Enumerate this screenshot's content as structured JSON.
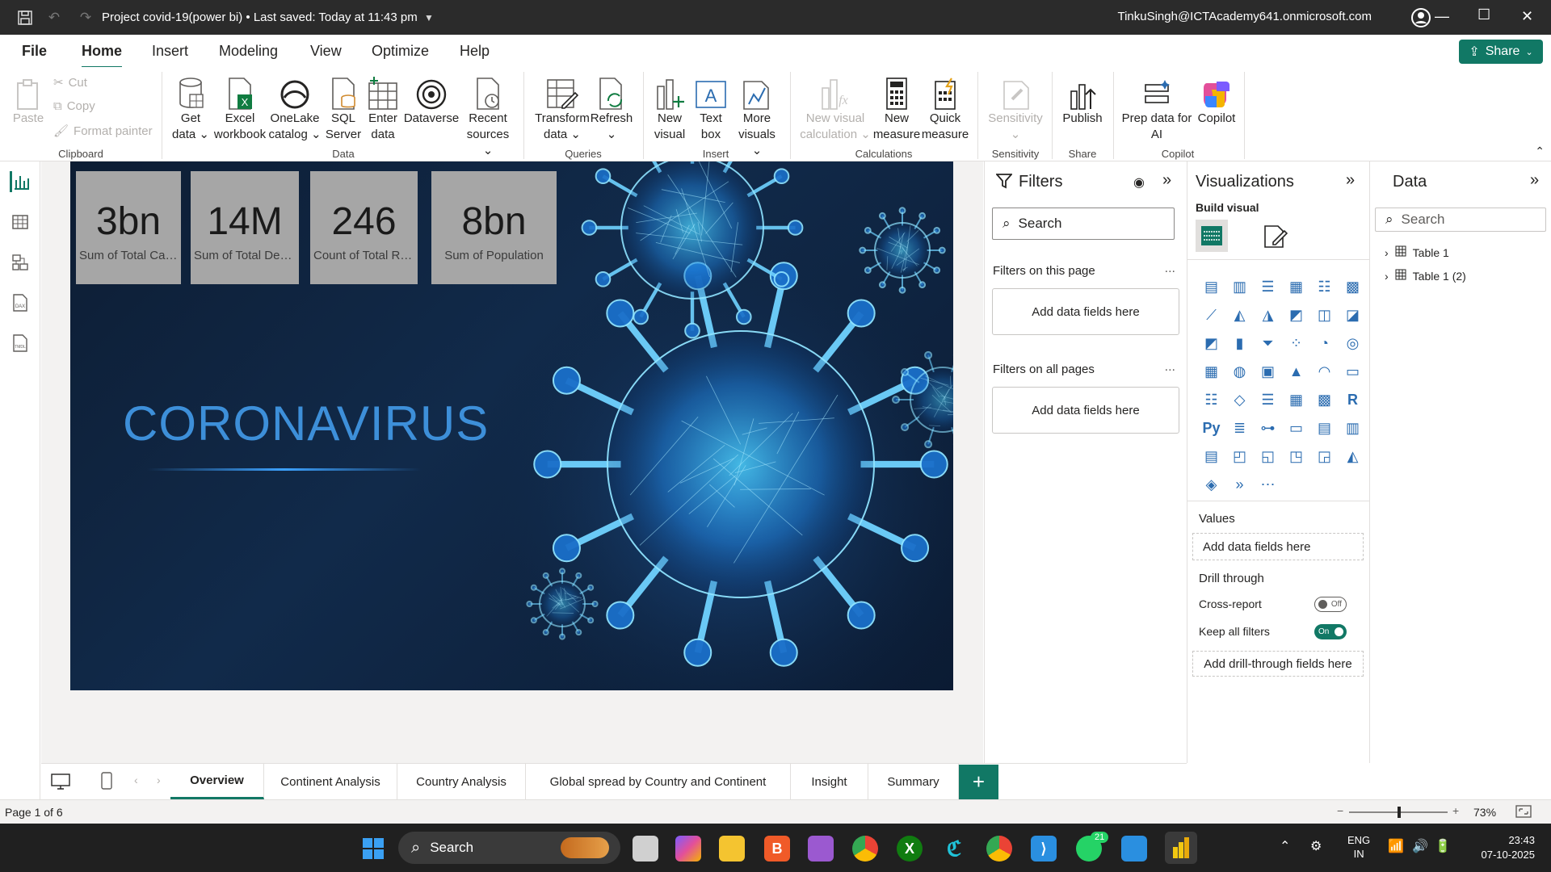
{
  "titlebar": {
    "title": "Project covid-19(power bi) • Last saved: Today at 11:43 pm",
    "account": "TinkuSingh@ICTAcademy641.onmicrosoft.com"
  },
  "menu": {
    "items": [
      "File",
      "Home",
      "Insert",
      "Modeling",
      "View",
      "Optimize",
      "Help"
    ],
    "active": "Home",
    "share": "Share"
  },
  "ribbon": {
    "clipboard": {
      "paste": "Paste",
      "cut": "Cut",
      "copy": "Copy",
      "format_painter": "Format painter",
      "group": "Clipboard"
    },
    "data": {
      "get_data": [
        "Get",
        "data ⌄"
      ],
      "excel": [
        "Excel",
        "workbook"
      ],
      "onelake": [
        "OneLake",
        "catalog ⌄"
      ],
      "sql": [
        "SQL",
        "Server"
      ],
      "enter": [
        "Enter",
        "data"
      ],
      "dataverse": [
        "Dataverse",
        ""
      ],
      "recent": [
        "Recent",
        "sources ⌄"
      ],
      "group": "Data"
    },
    "queries": {
      "transform": [
        "Transform",
        "data ⌄"
      ],
      "refresh": [
        "Refresh",
        "⌄"
      ],
      "group": "Queries"
    },
    "insert": {
      "new_visual": [
        "New",
        "visual"
      ],
      "text_box": [
        "Text",
        "box"
      ],
      "more_visuals": [
        "More",
        "visuals ⌄"
      ],
      "group": "Insert"
    },
    "calculations": {
      "new_visual_calc": [
        "New visual",
        "calculation ⌄"
      ],
      "new_measure": [
        "New",
        "measure"
      ],
      "quick_measure": [
        "Quick",
        "measure"
      ],
      "group": "Calculations"
    },
    "sensitivity": {
      "label": [
        "Sensitivity",
        "⌄"
      ],
      "group": "Sensitivity"
    },
    "share": {
      "publish": [
        "Publish",
        ""
      ],
      "group": "Share"
    },
    "copilot": {
      "prep": [
        "Prep data for",
        "AI"
      ],
      "copilot": [
        "Copilot",
        ""
      ],
      "group": "Copilot"
    }
  },
  "report": {
    "cards": [
      {
        "value": "3bn",
        "label": "Sum of Total Cases"
      },
      {
        "value": "14M",
        "label": "Sum of Total Deat..."
      },
      {
        "value": "246",
        "label": "Count of Total Re..."
      },
      {
        "value": "8bn",
        "label": "Sum of Population"
      }
    ],
    "headline": "CORONAVIRUS"
  },
  "filters": {
    "title": "Filters",
    "search_placeholder": "Search",
    "this_page": "Filters on this page",
    "all_pages": "Filters on all pages",
    "drop_hint": "Add data fields here",
    "more": "..."
  },
  "visualizations": {
    "title": "Visualizations",
    "build_visual": "Build visual",
    "values": "Values",
    "values_hint": "Add data fields here",
    "drill_through": "Drill through",
    "cross_report": "Cross-report",
    "cross_report_state": "Off",
    "keep_all_filters": "Keep all filters",
    "keep_all_filters_state": "On",
    "drill_hint": "Add drill-through fields here"
  },
  "data_pane": {
    "title": "Data",
    "search_placeholder": "Search",
    "tables": [
      "Table 1",
      "Table 1 (2)"
    ]
  },
  "tabs": {
    "items": [
      "Overview",
      "Continent Analysis",
      "Country Analysis",
      "Global spread by Country and Continent",
      "Insight",
      "Summary"
    ],
    "active": "Overview",
    "add": "+"
  },
  "status": {
    "page": "Page 1 of 6",
    "zoom": "73%",
    "zoom_level": 0.73
  },
  "taskbar": {
    "search": "Search",
    "lang": [
      "ENG",
      "IN"
    ],
    "time": "23:43",
    "date": "07-10-2025",
    "whatsapp_badge": "21"
  },
  "colors": {
    "accent": "#117865",
    "title_bg": "#2b2b2b",
    "card_bg": "#a6a6a6",
    "headline": "#3d8fd9",
    "report_bg": "#0d1d33"
  }
}
